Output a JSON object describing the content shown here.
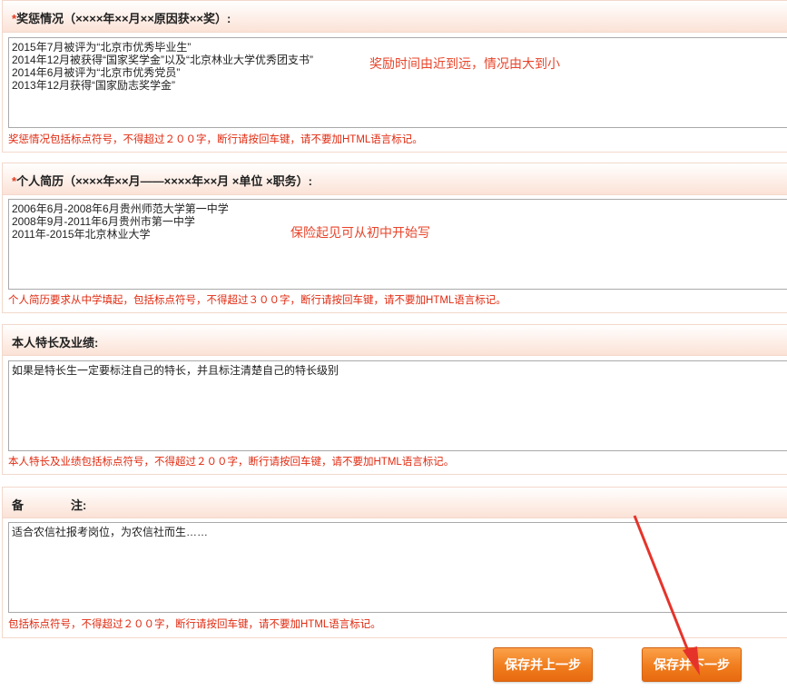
{
  "sections": [
    {
      "title_req": "*",
      "title": "奖惩情况（××××年××月××原因获××奖）:",
      "content": [
        "2015年7月被评为“北京市优秀毕业生”",
        "2014年12月被获得“国家奖学金”以及“北京林业大学优秀团支书”",
        "2014年6月被评为“北京市优秀党员”",
        "2013年12月获得“国家励志奖学金”"
      ],
      "annotation": "奖励时间由近到远，情况由大到小",
      "hint": "奖惩情况包括标点符号，不得超过２００字，断行请按回车键，请不要加HTML语言标记。"
    },
    {
      "title_req": "*",
      "title": "个人简历（××××年××月——××××年××月 ×单位 ×职务）:",
      "content": [
        "2006年6月-2008年6月贵州师范大学第一中学",
        "2008年9月-2011年6月贵州市第一中学",
        "2011年-2015年北京林业大学"
      ],
      "annotation": "保险起见可从初中开始写",
      "hint": "个人简历要求从中学填起，包括标点符号，不得超过３００字，断行请按回车键，请不要加HTML语言标记。"
    },
    {
      "title_req": "",
      "title": "本人特长及业绩:",
      "content": [
        "如果是特长生一定要标注自己的特长，并且标注清楚自己的特长级别"
      ],
      "annotation": "",
      "hint": "本人特长及业绩包括标点符号，不得超过２００字，断行请按回车键，请不要加HTML语言标记。"
    },
    {
      "title_req": "",
      "title": "备　　　　注:",
      "content": [
        "适合农信社报考岗位，为农信社而生……"
      ],
      "annotation": "",
      "hint": "包括标点符号，不得超过２００字，断行请按回车键，请不要加HTML语言标记。"
    }
  ],
  "buttons": {
    "prev": "保存并上一步",
    "next": "保存并下一步"
  },
  "colors": {
    "accent_orange": "#f07d1e",
    "hint_red": "#e02a10",
    "annotation_red": "#e8442a",
    "header_tint": "#fbe2d6"
  }
}
